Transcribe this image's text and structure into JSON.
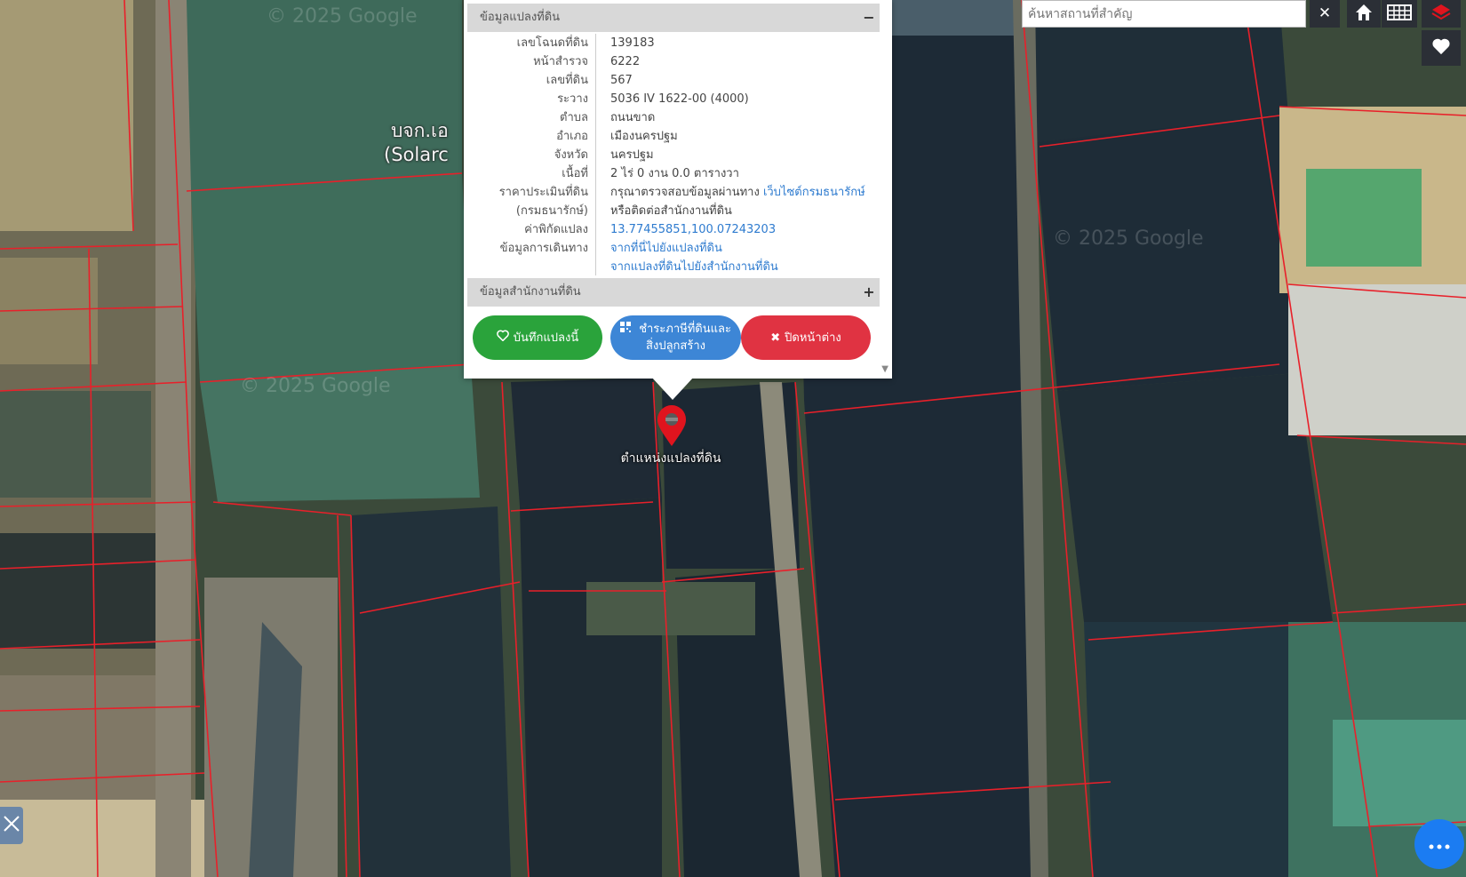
{
  "map": {
    "poi_label_line1": "บจก.เอ",
    "poi_label_line2": "(Solarc",
    "watermark": "© 2025 Google",
    "marker_label": "ตำแหน่งแปลงที่ดิน"
  },
  "popup": {
    "header": "ข้อมูลแปลงที่ดิน",
    "header_toggle": "−",
    "rows": [
      {
        "label": "เลขโฉนดที่ดิน",
        "value": "139183"
      },
      {
        "label": "หน้าสำรวจ",
        "value": "6222"
      },
      {
        "label": "เลขที่ดิน",
        "value": "567"
      },
      {
        "label": "ระวาง",
        "value": "5036 IV 1622-00 (4000)"
      },
      {
        "label": "ตำบล",
        "value": "ถนนขาด"
      },
      {
        "label": "อำเภอ",
        "value": "เมืองนครปฐม"
      },
      {
        "label": "จังหวัด",
        "value": "นครปฐม"
      },
      {
        "label": "เนื้อที่",
        "value": "2 ไร่ 0 งาน 0.0 ตารางวา"
      }
    ],
    "price_label_1": "ราคาประเมินที่ดิน",
    "price_label_2": "(กรมธนารักษ์)",
    "price_text_1": "กรุณาตรวจสอบข้อมูลผ่านทาง ",
    "price_link": "เว็บไซต์กรมธนารักษ์",
    "price_text_2": "หรือติดต่อสำนักงานที่ดิน",
    "coord_label": "ค่าพิกัดแปลง",
    "coord_value": "13.77455851,100.07243203",
    "route_label": "ข้อมูลการเดินทาง",
    "route_link_1": "จากที่นี่ไปยังแปลงที่ดิน",
    "route_link_2": "จากแปลงที่ดินไปยังสำนักงานที่ดิน",
    "office_header": "ข้อมูลสำนักงานที่ดิน",
    "office_toggle": "+",
    "btn_save": "บันทึกแปลงนี้",
    "btn_tax_1": "ชำระภาษีที่ดินและ",
    "btn_tax_2": "สิ่งปลูกสร้าง",
    "btn_close": "ปิดหน้าต่าง"
  },
  "search": {
    "placeholder": "ค้นหาสถานที่สำคัญ",
    "clear": "✕"
  },
  "colors": {
    "parcel_line": "#e8202a",
    "green_button": "#2aa33b",
    "blue_button": "#3d86d6",
    "red_button": "#e03342",
    "link": "#2e7bcf",
    "toolbar": "#2b2f36",
    "chat": "#1b7cf2"
  }
}
